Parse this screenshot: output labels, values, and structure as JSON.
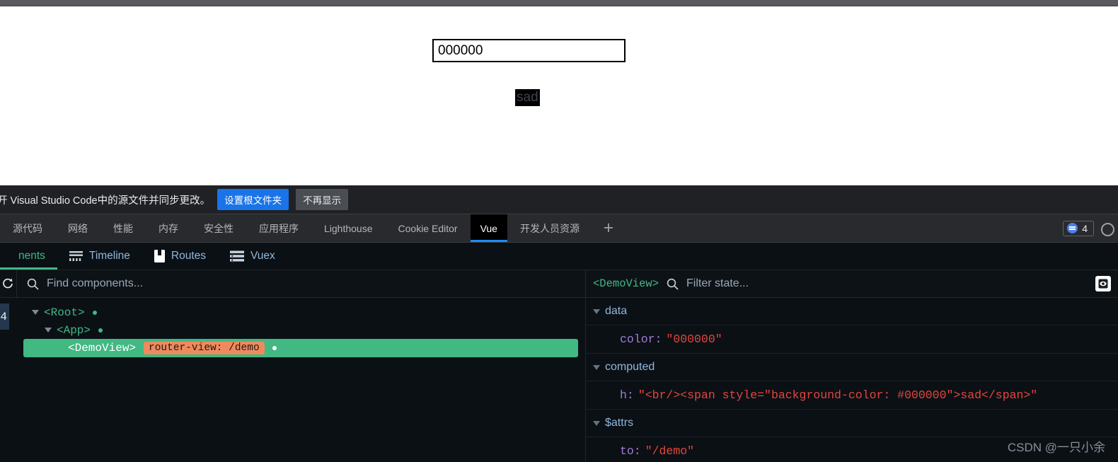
{
  "page": {
    "color_input_value": "000000",
    "rendered_text": "sad",
    "rendered_text_bg": "#000000"
  },
  "notify_bar": {
    "message": "开 Visual Studio Code中的源文件并同步更改。",
    "primary_button": "设置根文件夹",
    "secondary_button": "不再显示"
  },
  "devtools": {
    "tabs": [
      {
        "label": "源代码",
        "active": false
      },
      {
        "label": "网络",
        "active": false
      },
      {
        "label": "性能",
        "active": false
      },
      {
        "label": "内存",
        "active": false
      },
      {
        "label": "安全性",
        "active": false
      },
      {
        "label": "应用程序",
        "active": false
      },
      {
        "label": "Lighthouse",
        "active": false
      },
      {
        "label": "Cookie Editor",
        "active": false
      },
      {
        "label": "Vue",
        "active": true
      },
      {
        "label": "开发人员资源",
        "active": false
      }
    ],
    "add_tab_label": "+",
    "message_count": "4",
    "active_tab_accent": "#1a8cff"
  },
  "vue_panel": {
    "subtabs": [
      {
        "label": "nents",
        "icon": "components-icon",
        "active": true
      },
      {
        "label": "Timeline",
        "icon": "timeline-icon",
        "active": false
      },
      {
        "label": "Routes",
        "icon": "routes-icon",
        "active": false
      },
      {
        "label": "Vuex",
        "icon": "vuex-icon",
        "active": false
      }
    ],
    "accent": "#42b883",
    "tree": {
      "search_placeholder": "Find components...",
      "component_count": "4",
      "rows": [
        {
          "label": "<Root>",
          "depth": 0,
          "selected": false,
          "badge": ""
        },
        {
          "label": "<App>",
          "depth": 1,
          "selected": false,
          "badge": ""
        },
        {
          "label": "<DemoView>",
          "depth": 2,
          "selected": true,
          "badge": "router-view: /demo"
        }
      ]
    },
    "state": {
      "component_name": "<DemoView>",
      "filter_placeholder": "Filter state...",
      "groups": [
        {
          "name": "data",
          "entries": [
            {
              "key": "color:",
              "value": "\"000000\""
            }
          ]
        },
        {
          "name": "computed",
          "entries": [
            {
              "key": "h:",
              "value": "\"<br/><span style=\"background-color: #000000\">sad</span>\""
            }
          ]
        },
        {
          "name": "$attrs",
          "entries": [
            {
              "key": "to:",
              "value": "\"/demo\""
            }
          ]
        }
      ]
    }
  },
  "watermark": "CSDN @一只小余"
}
